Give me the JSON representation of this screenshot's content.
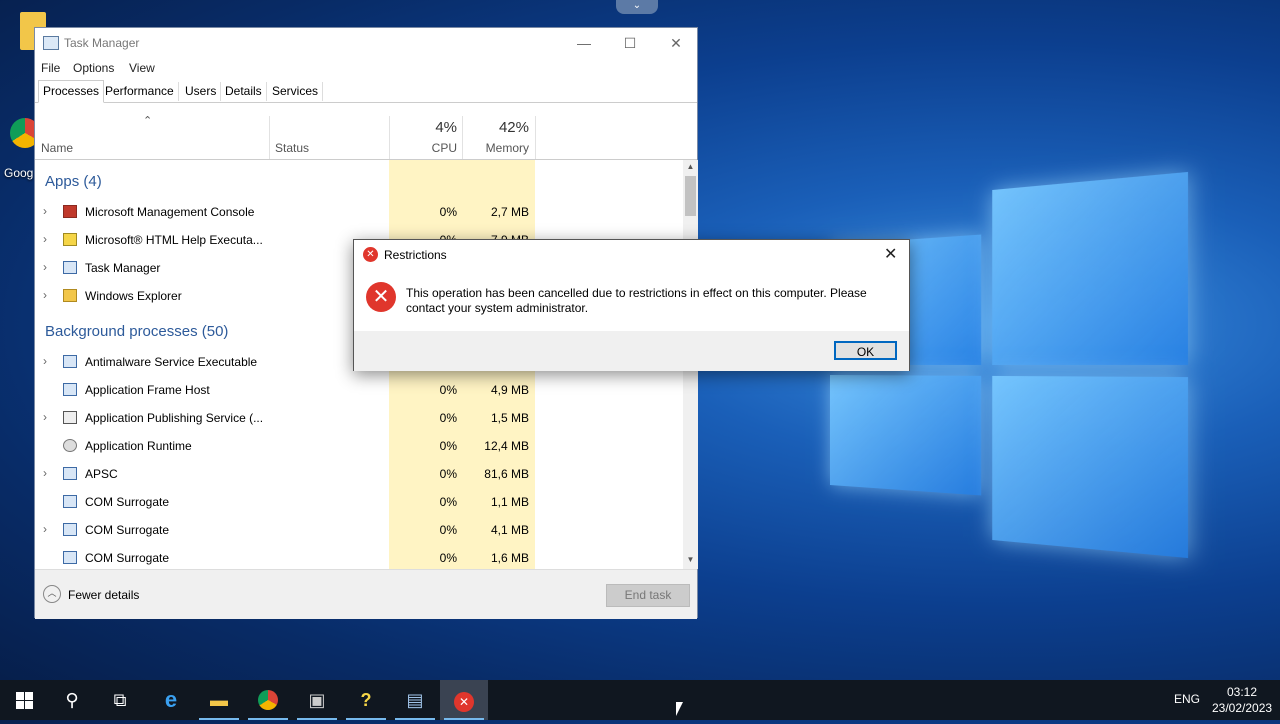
{
  "desktop": {
    "chrome_label": "Goog"
  },
  "task_manager": {
    "title": "Task Manager",
    "menu": [
      "File",
      "Options",
      "View"
    ],
    "tabs": [
      "Processes",
      "Performance",
      "Users",
      "Details",
      "Services"
    ],
    "active_tab": "Processes",
    "columns": {
      "name": "Name",
      "status": "Status",
      "cpu": "CPU",
      "memory": "Memory",
      "cpu_pct": "4%",
      "memory_pct": "42%"
    },
    "apps_header": "Apps (4)",
    "apps": [
      {
        "name": "Microsoft Management Console",
        "cpu": "0%",
        "mem": "2,7 MB"
      },
      {
        "name": "Microsoft® HTML Help Executa...",
        "cpu": "0%",
        "mem": "7,9 MB"
      },
      {
        "name": "Task Manager",
        "cpu": "",
        "mem": ""
      },
      {
        "name": "Windows Explorer",
        "cpu": "",
        "mem": ""
      }
    ],
    "bg_header": "Background processes (50)",
    "bg": [
      {
        "name": "Antimalware Service Executable",
        "cpu": "",
        "mem": ""
      },
      {
        "name": "Application Frame Host",
        "cpu": "0%",
        "mem": "4,9 MB"
      },
      {
        "name": "Application Publishing Service (...",
        "cpu": "0%",
        "mem": "1,5 MB"
      },
      {
        "name": "Application Runtime",
        "cpu": "0%",
        "mem": "12,4 MB"
      },
      {
        "name": "APSC",
        "cpu": "0%",
        "mem": "81,6 MB"
      },
      {
        "name": "COM Surrogate",
        "cpu": "0%",
        "mem": "1,1 MB"
      },
      {
        "name": "COM Surrogate",
        "cpu": "0%",
        "mem": "4,1 MB"
      },
      {
        "name": "COM Surrogate",
        "cpu": "0%",
        "mem": "1,6 MB"
      }
    ],
    "fewer_details": "Fewer details",
    "end_task": "End task"
  },
  "dialog": {
    "title": "Restrictions",
    "message": "This operation has been cancelled due to restrictions in effect on this computer. Please contact your system administrator.",
    "ok": "OK"
  },
  "taskbar": {
    "lang": "ENG",
    "time": "03:12",
    "date": "23/02/2023",
    "icons": [
      "windows-start-icon",
      "search-icon",
      "task-view-icon",
      "internet-explorer-icon",
      "file-explorer-icon",
      "chrome-icon",
      "app-installer-icon",
      "help-icon",
      "task-manager-icon",
      "error-icon"
    ]
  },
  "colors": {
    "accent": "#0067c0",
    "highlight": "#fff4c4",
    "group": "#2d5a9a",
    "error": "#e0362c"
  }
}
